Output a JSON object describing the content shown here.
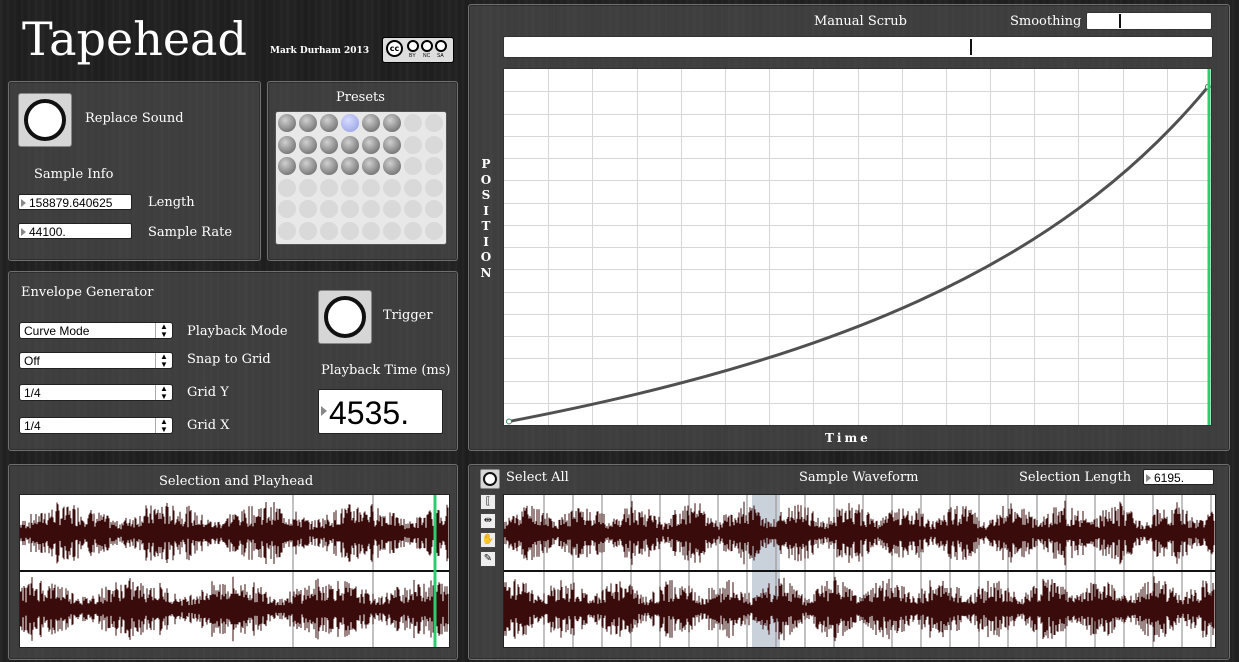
{
  "app": {
    "title": "Tapehead",
    "author": "Mark Durham 2013",
    "license": [
      "BY",
      "NC",
      "SA"
    ]
  },
  "sound": {
    "replace_label": "Replace Sound"
  },
  "sample_info": {
    "heading": "Sample Info",
    "length_value": "158879.640625",
    "length_label": "Length",
    "rate_value": "44100.",
    "rate_label": "Sample Rate"
  },
  "presets": {
    "heading": "Presets",
    "grid_rows": [
      [
        1,
        1,
        1,
        2,
        1,
        1,
        0,
        0
      ],
      [
        1,
        1,
        1,
        1,
        1,
        1,
        0,
        0
      ],
      [
        1,
        1,
        1,
        1,
        1,
        1,
        0,
        0
      ],
      [
        0,
        0,
        0,
        0,
        0,
        0,
        0,
        0
      ],
      [
        0,
        0,
        0,
        0,
        0,
        0,
        0,
        0
      ],
      [
        0,
        0,
        0,
        0,
        0,
        0,
        0,
        0
      ]
    ]
  },
  "envelope": {
    "heading": "Envelope Generator",
    "playback_mode": {
      "value": "Curve Mode",
      "label": "Playback Mode"
    },
    "snap": {
      "value": "Off",
      "label": "Snap to Grid"
    },
    "grid_y": {
      "value": "1/4",
      "label": "Grid Y"
    },
    "grid_x": {
      "value": "1/4",
      "label": "Grid X"
    },
    "trigger_label": "Trigger",
    "playback_time_label": "Playback Time (ms)",
    "playback_time_value": "4535."
  },
  "scrub": {
    "manual_label": "Manual Scrub",
    "manual_level": 0.66,
    "smoothing_label": "Smoothing",
    "smoothing_level": 0.26
  },
  "curve": {
    "y_label": [
      "P",
      "O",
      "S",
      "I",
      "T",
      "I",
      "O",
      "N"
    ],
    "x_label": "Time",
    "playhead_fraction": 1.0,
    "start_y": 0.01,
    "end_y": 0.95
  },
  "selection_playhead": {
    "heading": "Selection and Playhead"
  },
  "sample_waveform": {
    "select_all_label": "Select All",
    "heading": "Sample Waveform",
    "selection_length_label": "Selection Length",
    "selection_length_value": "6195.",
    "tools": [
      "selection-tool-icon",
      "move-tool-icon",
      "hand-tool-icon",
      "pencil-tool-icon"
    ]
  }
}
